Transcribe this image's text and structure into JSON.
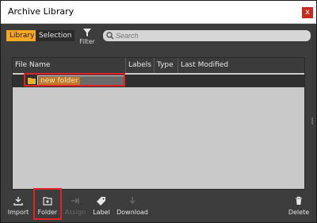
{
  "window": {
    "title": "Archive Library",
    "close_label": "x"
  },
  "tabs": {
    "library": "Library",
    "selection": "Selection"
  },
  "filter": {
    "label": "Filter"
  },
  "search": {
    "placeholder": "Search",
    "value": ""
  },
  "table": {
    "columns": [
      "File Name",
      "Labels",
      "Type",
      "Last Modified"
    ],
    "rows": [
      {
        "name": "new folder",
        "labels": "",
        "type": "",
        "last_modified": ""
      }
    ]
  },
  "bottom": {
    "import": "Import",
    "folder": "Folder",
    "assign": "Assign",
    "label": "Label",
    "download": "Download",
    "delete": "Delete"
  },
  "colors": {
    "accent": "#f5a623",
    "highlight": "#e02424",
    "background": "#3c3c3c"
  }
}
